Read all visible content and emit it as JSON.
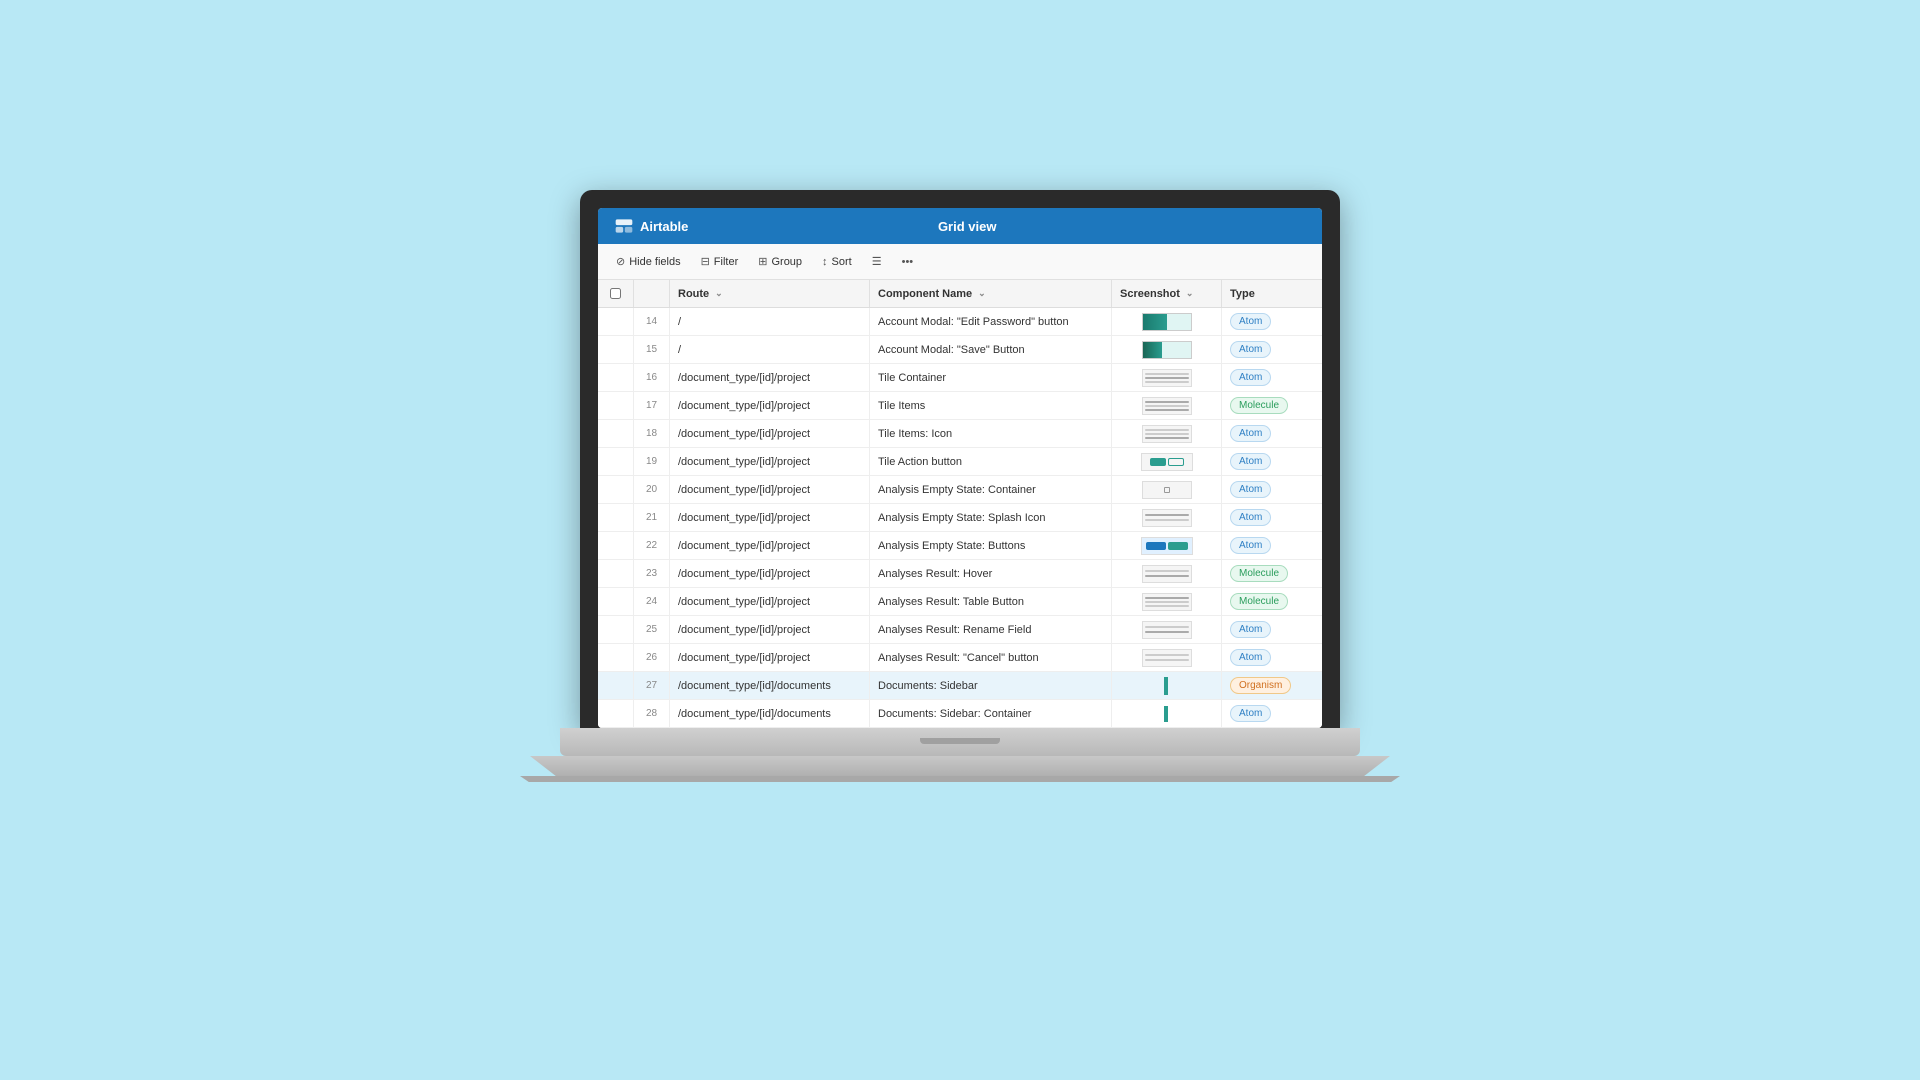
{
  "app": {
    "title": "Grid view",
    "logo_text": "Airtable"
  },
  "toolbar": {
    "hide_fields": "Hide fields",
    "filter": "Filter",
    "group": "Group",
    "sort": "Sort"
  },
  "columns": {
    "route": "Route",
    "component_name": "Component Name",
    "screenshot": "Screenshot",
    "type": "Type"
  },
  "rows": [
    {
      "id": 14,
      "route": "/",
      "component": "Account Modal: \"Edit Password\" button",
      "type": "Atom"
    },
    {
      "id": 15,
      "route": "/",
      "component": "Account Modal: \"Save\" Button",
      "type": "Atom"
    },
    {
      "id": 16,
      "route": "/document_type/[id]/project",
      "component": "Tile Container",
      "type": "Atom"
    },
    {
      "id": 17,
      "route": "/document_type/[id]/project",
      "component": "Tile Items",
      "type": "Molecule"
    },
    {
      "id": 18,
      "route": "/document_type/[id]/project",
      "component": "Tile Items: Icon",
      "type": "Atom"
    },
    {
      "id": 19,
      "route": "/document_type/[id]/project",
      "component": "Tile Action button",
      "type": "Atom"
    },
    {
      "id": 20,
      "route": "/document_type/[id]/project",
      "component": "Analysis Empty State: Container",
      "type": "Atom"
    },
    {
      "id": 21,
      "route": "/document_type/[id]/project",
      "component": "Analysis Empty State: Splash Icon",
      "type": "Atom"
    },
    {
      "id": 22,
      "route": "/document_type/[id]/project",
      "component": "Analysis Empty State: Buttons",
      "type": "Atom"
    },
    {
      "id": 23,
      "route": "/document_type/[id]/project",
      "component": "Analyses Result: Hover",
      "type": "Molecule"
    },
    {
      "id": 24,
      "route": "/document_type/[id]/project",
      "component": "Analyses Result: Table Button",
      "type": "Molecule"
    },
    {
      "id": 25,
      "route": "/document_type/[id]/project",
      "component": "Analyses Result: Rename Field",
      "type": "Atom"
    },
    {
      "id": 26,
      "route": "/document_type/[id]/project",
      "component": "Analyses Result: \"Cancel\" button",
      "type": "Atom"
    },
    {
      "id": 27,
      "route": "/document_type/[id]/documents",
      "component": "Documents: Sidebar",
      "type": "Organism"
    },
    {
      "id": 28,
      "route": "/document_type/[id]/documents",
      "component": "Documents: Sidebar: Container",
      "type": "Atom"
    }
  ]
}
